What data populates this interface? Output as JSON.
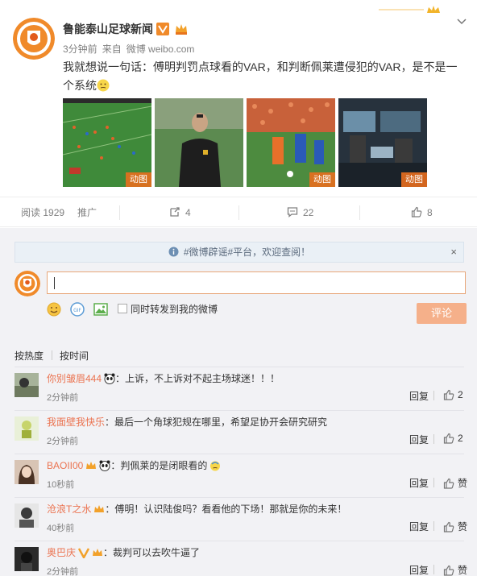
{
  "post": {
    "author": "鲁能泰山足球新闻",
    "time": "3分钟前",
    "source_prefix": "来自",
    "source": "微博 weibo.com",
    "text": "我就想说一句话：傅明判罚点球看的VAR，和判断佩莱遭侵犯的VAR，是不是一个系统",
    "gif_label": "动图",
    "icons": [
      "verified-v-icon",
      "crown-member-icon",
      "chevron-down-icon",
      "think-emoji-icon"
    ]
  },
  "actions": {
    "reads_label": "阅读",
    "reads": "1929",
    "promote": "推广",
    "shares": "4",
    "comments": "22",
    "likes": "8"
  },
  "comment_area": {
    "notice": "#微博辟谣#平台，欢迎查阅！",
    "notice_close": "×",
    "forward_label": "同时转发到我的微博",
    "submit": "评论",
    "sort_hot": "按热度",
    "sort_time": "按时间"
  },
  "comments": [
    {
      "user": "你别皱眉444",
      "text": "：上诉，不上诉对不起主场球迷！！！",
      "time": "2分钟前",
      "reply": "回复",
      "likes": "2"
    },
    {
      "user": "我面壁我快乐",
      "text": "：最后一个角球犯规在哪里，希望足协开会研究研究",
      "time": "2分钟前",
      "reply": "回复",
      "likes": "2"
    },
    {
      "user": "BAOII00",
      "text": "：判佩莱的是闭眼看的",
      "time": "10秒前",
      "reply": "回复",
      "likes": "赞"
    },
    {
      "user": "沧浪T之水",
      "text": "：傅明！认识陆俊吗？看看他的下场！那就是你的未来！",
      "time": "40秒前",
      "reply": "回复",
      "likes": "赞"
    },
    {
      "user": "奥巴庆",
      "text": "：裁判可以去吹牛逼了",
      "time": "2分钟前",
      "reply": "回复",
      "likes": "赞"
    }
  ],
  "colors": {
    "accent": "#eb7350",
    "submit_disabled": "#f5b08a",
    "notice_bg": "#eaf0f6"
  }
}
